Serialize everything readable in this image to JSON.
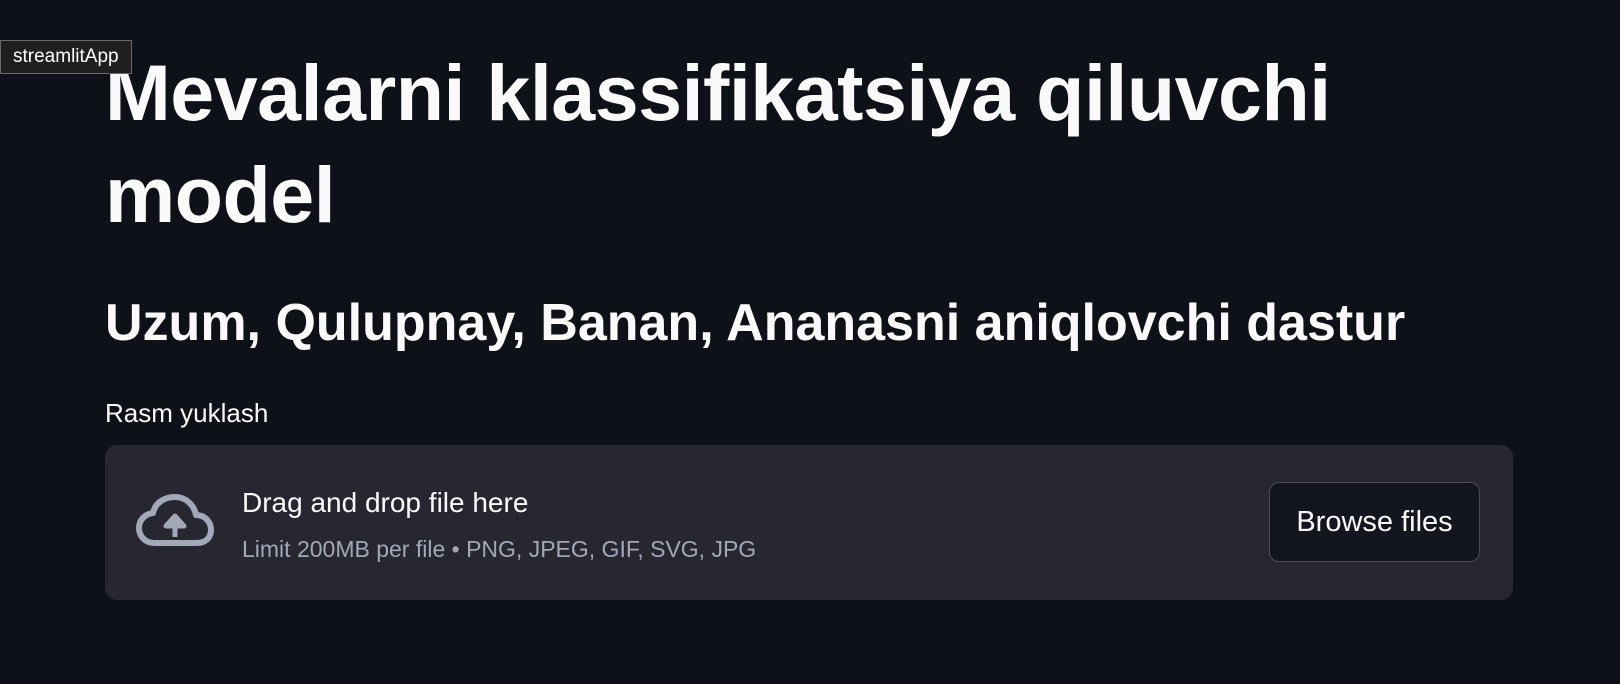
{
  "app": {
    "tag": "streamlitApp"
  },
  "main": {
    "title": "Mevalarni klassifikatsiya qiluvchi model",
    "subtitle": "Uzum, Qulupnay, Banan, Ananasni aniqlovchi dastur"
  },
  "uploader": {
    "label": "Rasm yuklash",
    "drop_text": "Drag and drop file here",
    "limit_text": "Limit 200MB per file • PNG, JPEG, GIF, SVG, JPG",
    "browse_label": "Browse files",
    "icon": "cloud-upload-icon"
  },
  "colors": {
    "background": "#0e1117",
    "dropzone": "#262730",
    "text": "#fafafa",
    "muted_text": "#a3a8b8",
    "icon": "#a3a8b8"
  }
}
